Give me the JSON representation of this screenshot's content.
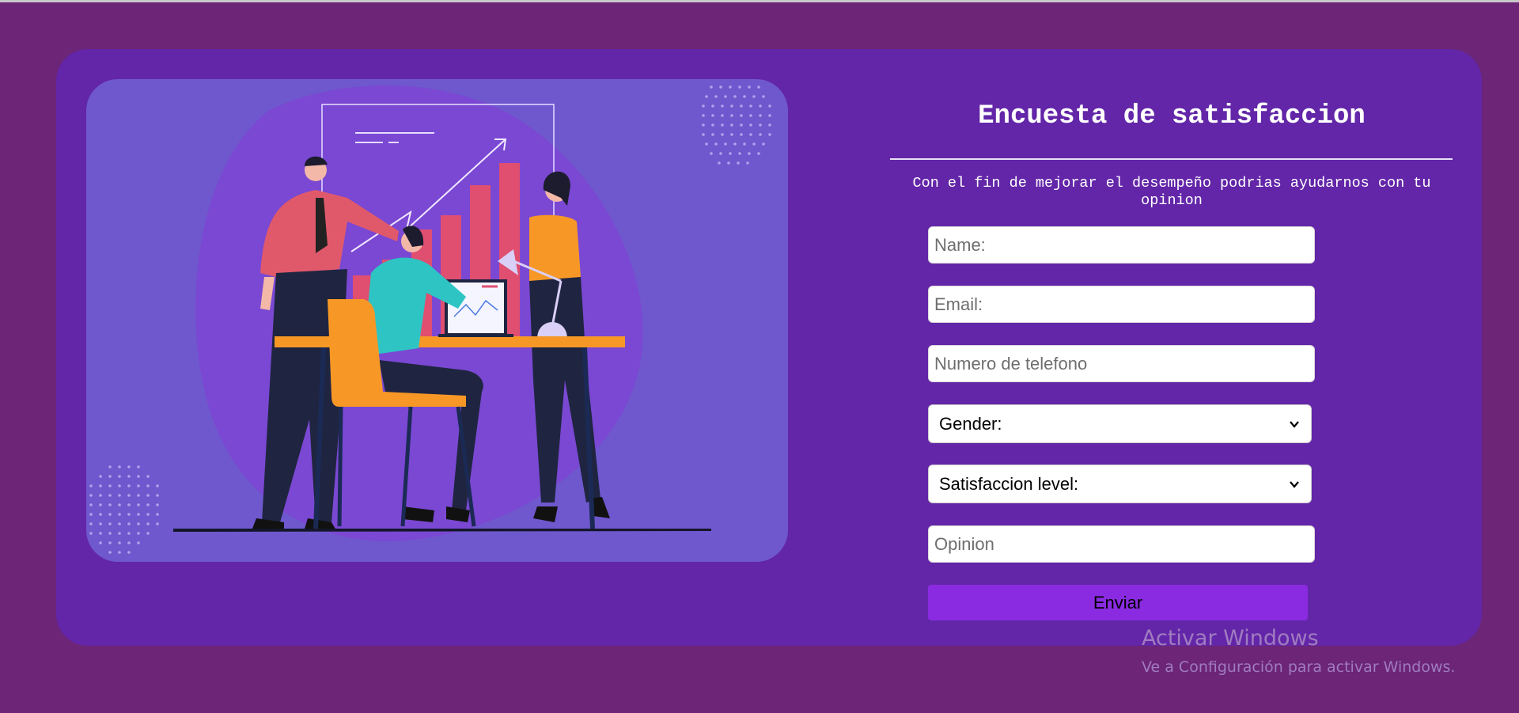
{
  "survey": {
    "title": "Encuesta de satisfaccion",
    "subtitle": "Con el fin de mejorar el desempeño podrias ayudarnos con tu opinion",
    "fields": {
      "name_placeholder": "Name:",
      "email_placeholder": "Email:",
      "phone_placeholder": "Numero de telefono",
      "gender_selected": "Gender:",
      "satisfaction_selected": "Satisfaccion level:",
      "opinion_placeholder": "Opinion"
    },
    "submit_label": "Enviar"
  },
  "watermark": {
    "line1": "Activar Windows",
    "line2": "Ve a Configuración para activar Windows."
  },
  "colors": {
    "page_background": "#6c2577",
    "card_background": "#6326a8",
    "illustration_background": "#6f58cd",
    "submit_button": "#8a2be2"
  },
  "icons": {
    "select_arrow": "chevron-down-icon"
  }
}
